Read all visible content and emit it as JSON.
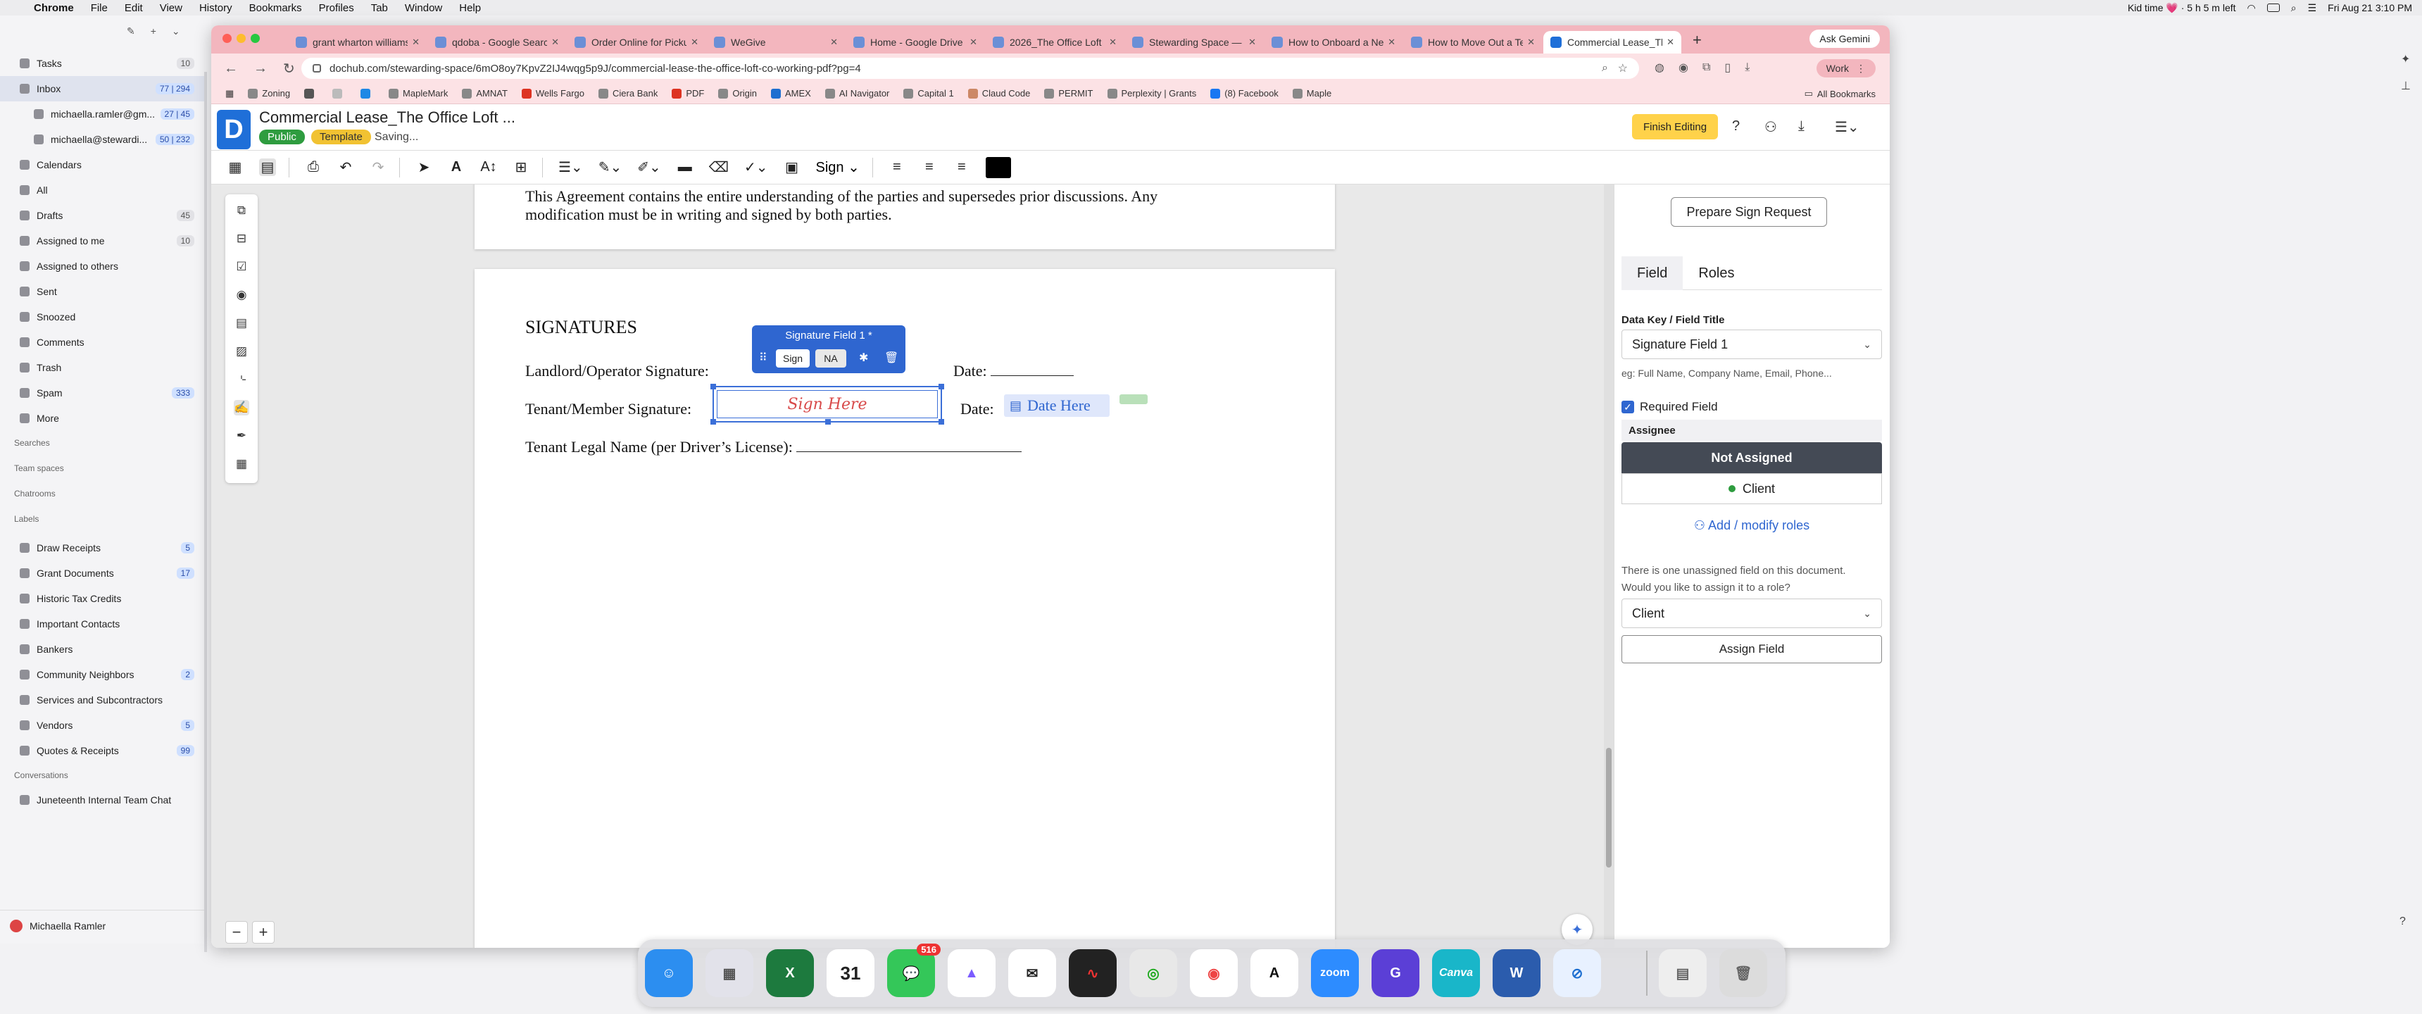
{
  "menubar": {
    "app": "Chrome",
    "items": [
      "File",
      "Edit",
      "View",
      "History",
      "Bookmarks",
      "Profiles",
      "Tab",
      "Window",
      "Help"
    ],
    "status_text": "Kid time 💗 · 5 h 5 m left",
    "datetime": "Fri Aug 21  3:10 PM"
  },
  "mail": {
    "items": [
      {
        "label": "Tasks",
        "count": "10"
      },
      {
        "label": "Inbox",
        "count": "77 | 294"
      },
      {
        "label": "michaella.ramler@gm...",
        "count": "27 | 45"
      },
      {
        "label": "michaella@stewardi...",
        "count": "50 | 232"
      },
      {
        "label": "Calendars",
        "count": ""
      },
      {
        "label": "All",
        "count": ""
      },
      {
        "label": "Drafts",
        "count": "45"
      },
      {
        "label": "Assigned to me",
        "count": "10"
      },
      {
        "label": "Assigned to others",
        "count": ""
      },
      {
        "label": "Sent",
        "count": ""
      },
      {
        "label": "Snoozed",
        "count": ""
      },
      {
        "label": "Comments",
        "count": ""
      },
      {
        "label": "Trash",
        "count": ""
      },
      {
        "label": "Spam",
        "count": "333"
      },
      {
        "label": "More",
        "count": ""
      }
    ],
    "sections": {
      "searches": "Searches",
      "team_spaces": "Team spaces",
      "chatrooms": "Chatrooms",
      "labels": "Labels",
      "conversations": "Conversations"
    },
    "labels": [
      {
        "label": "Draw Receipts",
        "count": "5"
      },
      {
        "label": "Grant Documents",
        "count": "17"
      },
      {
        "label": "Historic Tax Credits",
        "count": ""
      },
      {
        "label": "Important Contacts",
        "count": ""
      },
      {
        "label": "Bankers",
        "count": ""
      },
      {
        "label": "Community Neighbors",
        "count": "2"
      },
      {
        "label": "Services and Subcontractors",
        "count": ""
      },
      {
        "label": "Vendors",
        "count": "5"
      },
      {
        "label": "Quotes & Receipts",
        "count": "99"
      }
    ],
    "conversation": "Juneteenth Internal Team Chat",
    "user": "Michaella Ramler"
  },
  "browser": {
    "tabs": [
      "grant wharton williams",
      "qdoba - Google Search",
      "Order Online for Pickup",
      "WeGive",
      "Home - Google Drive",
      "2026_The Office Loft",
      "Stewarding Space — S",
      "How to Onboard a New",
      "How to Move Out a Te",
      "Commercial Lease_The"
    ],
    "ask_gemini": "Ask Gemini",
    "url": "dochub.com/stewarding-space/6mO8oy7KpvZ2IJ4wqg5p9J/commercial-lease-the-office-loft-co-working-pdf?pg=4",
    "profile": "Work",
    "bookmarks": [
      "Zoning",
      "MapleMark",
      "AMNAT",
      "Wells Fargo",
      "Ciera Bank",
      "PDF",
      "Origin",
      "AMEX",
      "AI Navigator",
      "Capital 1",
      "Claud Code",
      "PERMIT",
      "Perplexity | Grants",
      "(8) Facebook",
      "Maple"
    ],
    "all_bookmarks": "All Bookmarks"
  },
  "app": {
    "logo": "D",
    "title": "Commercial Lease_The Office Loft ...",
    "badge_public": "Public",
    "badge_template": "Template",
    "status": "Saving...",
    "finish_editing": "Finish Editing",
    "sign_menu": "Sign"
  },
  "document": {
    "page1_line1": "This Agreement contains the entire understanding of the parties and supersedes prior discussions. Any",
    "page1_line2": "modification must be in writing and signed by both parties.",
    "heading": "SIGNATURES",
    "landlord_label": "Landlord/Operator Signature:",
    "date_label": "Date:",
    "tenant_label": "Tenant/Member Signature:",
    "legal_name_label": "Tenant Legal Name (per Driver’s License):",
    "sig_placeholder": "Sign Here",
    "date_placeholder": "Date Here",
    "popup_title": "Signature Field 1 *",
    "popup_sign": "Sign",
    "popup_na": "NA"
  },
  "panel": {
    "prepare": "Prepare Sign Request",
    "tab_field": "Field",
    "tab_roles": "Roles",
    "data_key_label": "Data Key / Field Title",
    "data_key_value": "Signature Field 1",
    "hint": "eg: Full Name, Company Name, Email, Phone...",
    "required": "Required Field",
    "assignee": "Assignee",
    "not_assigned": "Not Assigned",
    "client": "Client",
    "add_roles": "Add / modify roles",
    "unassigned_msg_1": "There is one unassigned field on this document.",
    "unassigned_msg_2": "Would you like to assign it to a role?",
    "role_select": "Client",
    "assign_field": "Assign Field"
  },
  "dock": {
    "messages_badge": "516",
    "calendar_day": "31",
    "zoom_label": "zoom",
    "canva_label": "Canva"
  }
}
